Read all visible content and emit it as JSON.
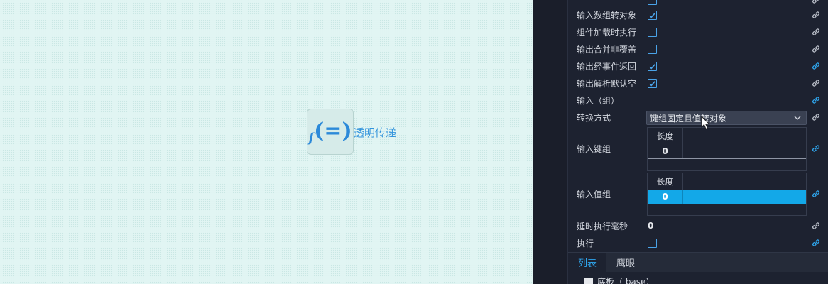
{
  "canvas": {
    "node": {
      "icon": "function-equals-icon",
      "label": "透明传递"
    }
  },
  "panel": {
    "rows": [
      {
        "label": "输入数组转对象",
        "type": "checkbox",
        "checked": true,
        "link": "link-gray"
      },
      {
        "label": "组件加载时执行",
        "type": "checkbox",
        "checked": false,
        "link": "link-gray"
      },
      {
        "label": "输出合并非覆盖",
        "type": "checkbox",
        "checked": false,
        "link": "link-gray"
      },
      {
        "label": "输出经事件返回",
        "type": "checkbox",
        "checked": true,
        "link": "link-blue"
      },
      {
        "label": "输出解析默认空",
        "type": "checkbox",
        "checked": true,
        "link": "link-gray"
      }
    ],
    "input_group_label": "输入（组）",
    "convert": {
      "label": "转换方式",
      "value": "键组固定且值转对象"
    },
    "key_group": {
      "label": "输入键组",
      "header": "长度",
      "value": "0"
    },
    "value_group": {
      "label": "输入值组",
      "header": "长度",
      "value": "0"
    },
    "delay": {
      "label": "延时执行毫秒",
      "value": "0"
    },
    "execute": {
      "label": "执行",
      "checked": false
    },
    "tabs": [
      "列表",
      "鹰眼"
    ],
    "tree_item": "底板（ base）"
  },
  "colors": {
    "accent": "#2fa6ee",
    "selected_row": "#13a8e8",
    "panel_bg": "#1d2230",
    "canvas_bg": "#e1f5f3"
  }
}
